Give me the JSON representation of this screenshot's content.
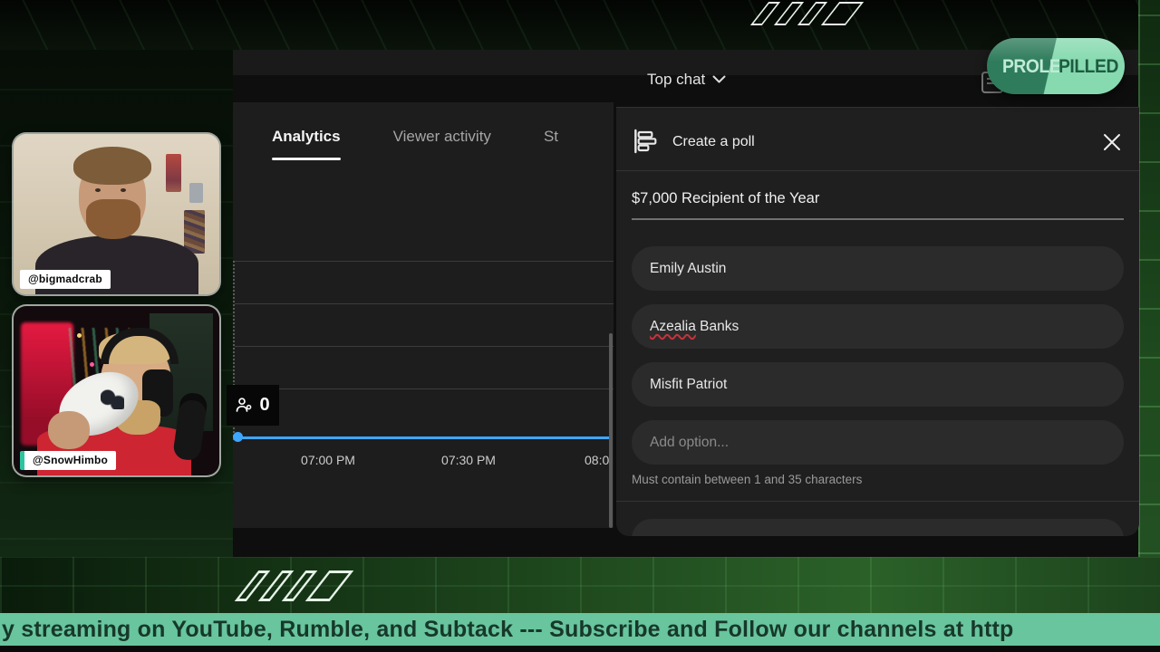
{
  "colors": {
    "ticker_bg": "#68c59d",
    "ticker_text": "#17382a",
    "badge_left_bg": "#2f7c5c",
    "badge_right_bg": "#87dab0",
    "chart_line_blue": "#3ea6ff",
    "spellcheck_red": "#c4333b"
  },
  "cams": [
    {
      "handle": "@bigmadcrab"
    },
    {
      "handle": "@SnowHimbo"
    }
  ],
  "badge": {
    "left": "PROLE",
    "right": "PILLED"
  },
  "ticker": {
    "text": "y streaming on YouTube, Rumble, and Subtack --- Subscribe and Follow our channels at http"
  },
  "studio": {
    "tabs": [
      {
        "label": "Analytics",
        "active": true
      },
      {
        "label": "Viewer activity",
        "active": false
      },
      {
        "label": "St",
        "active": false
      }
    ],
    "viewers_tooltip": {
      "count": "0"
    },
    "time_axis": [
      "07:00 PM",
      "07:30 PM",
      "08:0"
    ]
  },
  "chat": {
    "header": {
      "label": "Top chat"
    },
    "poll": {
      "title": "Create a poll",
      "question": "$7,000 Recipient of the Year",
      "options": [
        {
          "label": "Emily Austin"
        },
        {
          "label": "Azealia Banks",
          "misspelled_word": "Azealia"
        },
        {
          "label": "Misfit Patriot"
        }
      ],
      "add_option_placeholder": "Add option...",
      "helper_text": "Must contain between 1 and 35 characters"
    }
  },
  "chart_data": {
    "type": "line",
    "x": [
      "07:00 PM",
      "07:30 PM",
      "08:0"
    ],
    "series": [
      {
        "name": "Concurrent viewers",
        "values": [
          0,
          0,
          0
        ]
      }
    ],
    "ylim": [
      0,
      4
    ],
    "grid": true,
    "legend": "none",
    "annotations": [
      "tooltip shows 0 concurrent viewers at left edge of flat zero line"
    ]
  }
}
